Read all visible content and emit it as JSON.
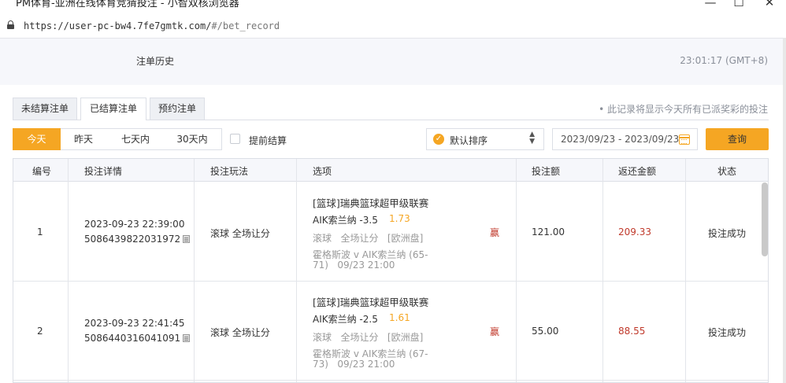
{
  "window": {
    "title": "PM体育-亚洲在线体育竞猜投注 - 小智双核浏览器",
    "controls": {
      "minimize": "—",
      "maximize": "☐",
      "close": "✕"
    }
  },
  "address": {
    "host": "https://user-pc-bw4.7fe7gmtk.com/",
    "path": "#/bet_record"
  },
  "header": {
    "title": "注单历史",
    "clock": "23:01:17 (GMT+8)"
  },
  "tabs": [
    {
      "label": "未结算注单",
      "active": false
    },
    {
      "label": "已结算注单",
      "active": true
    },
    {
      "label": "预约注单",
      "active": false
    }
  ],
  "note": "• 此记录将显示今天所有已派奖彩的投注",
  "filters": {
    "days": [
      {
        "label": "今天",
        "active": true
      },
      {
        "label": "昨天",
        "active": false
      },
      {
        "label": "七天内",
        "active": false
      },
      {
        "label": "30天内",
        "active": false
      }
    ],
    "early_settle_label": "提前结算",
    "sort_label": "默认排序",
    "sort_check": "✓",
    "sort_arrows": "⌃⌄",
    "date_range": "2023/09/23 - 2023/09/23",
    "query_label": "查询"
  },
  "table": {
    "headers": [
      "编号",
      "投注详情",
      "投注玩法",
      "选项",
      "投注额",
      "返还金额",
      "状态"
    ],
    "rows": [
      {
        "no": "1",
        "time": "2023-09-23 22:39:00",
        "order": "5086439822031972",
        "play": "滚球 全场让分",
        "league": "[篮球]瑞典篮球超甲级联赛",
        "pick": "AIK索兰纳 -3.5",
        "odds": "1.73",
        "market": "滚球   全场让分   [欧洲盘]",
        "match_line1": "霍格斯波 v AIK索兰纳 (65-",
        "match_line2": "71)   09/23 21:00",
        "result": "赢",
        "stake": "121.00",
        "return": "209.33",
        "status": "投注成功"
      },
      {
        "no": "2",
        "time": "2023-09-23 22:41:45",
        "order": "5086440316041091",
        "play": "滚球 全场让分",
        "league": "[篮球]瑞典篮球超甲级联赛",
        "pick": "AIK索兰纳 -2.5",
        "odds": "1.61",
        "market": "滚球   全场让分   [欧洲盘]",
        "match_line1": "霍格斯波 v AIK索兰纳 (67-",
        "match_line2": "73)   09/23 21:00",
        "result": "赢",
        "stake": "55.00",
        "return": "88.55",
        "status": "投注成功"
      }
    ]
  }
}
